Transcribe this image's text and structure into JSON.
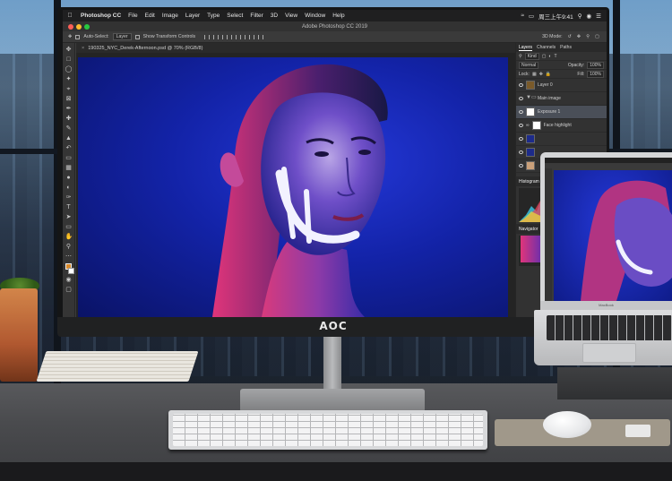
{
  "menubar": {
    "apple_icon": "apple-icon",
    "app_name": "Photoshop CC",
    "items": [
      "File",
      "Edit",
      "Image",
      "Layer",
      "Type",
      "Select",
      "Filter",
      "3D",
      "View",
      "Window",
      "Help"
    ],
    "clock": "周三上午9:41"
  },
  "titlebar": {
    "title": "Adobe Photoshop CC 2019"
  },
  "options": {
    "auto_select_label": "Auto-Select:",
    "auto_select_value": "Layer",
    "show_transform": "Show Transform Controls",
    "mode_label": "3D Mode:"
  },
  "document": {
    "tab_title": "190325_NYC_Derek-Afternoon.psd @ 70% (RGB/8)"
  },
  "layers_panel": {
    "tabs": [
      "Layers",
      "Channels",
      "Paths"
    ],
    "filter_kind": "Kind",
    "blend_mode": "Normal",
    "opacity_label": "Opacity:",
    "opacity_value": "100%",
    "lock_label": "Lock:",
    "fill_label": "Fill:",
    "fill_value": "100%",
    "layers": [
      {
        "name": "Layer 0",
        "type": "image"
      },
      {
        "name": "Main image",
        "type": "folder"
      },
      {
        "name": "Exposure 1",
        "type": "adjustment"
      },
      {
        "name": "Face highlight",
        "type": "mask"
      }
    ]
  },
  "histogram": {
    "title": "Histogram"
  },
  "navigator": {
    "title": "Navigator"
  },
  "monitor": {
    "brand": "AOC"
  },
  "laptop": {
    "brand": "MacBook"
  },
  "colors": {
    "foreground_swatch": "#d98a2b",
    "background_swatch": "#ffffff",
    "photo_blue": "#1a2bd0",
    "photo_magenta": "#e0357a"
  }
}
